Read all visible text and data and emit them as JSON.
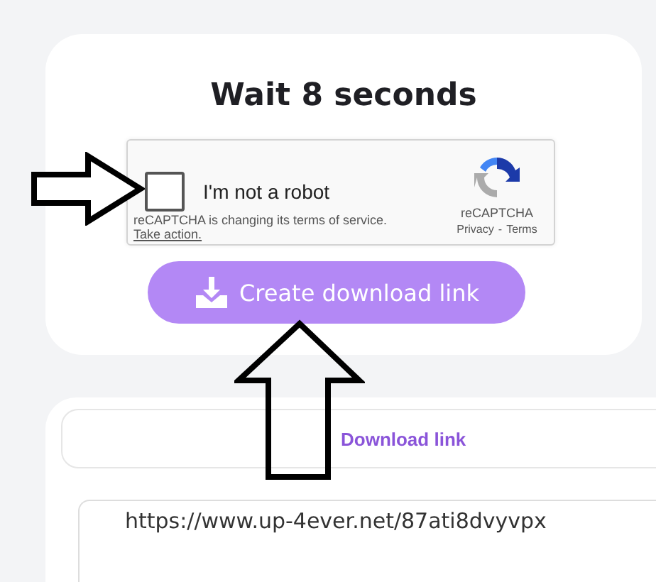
{
  "countdown_card": {
    "title": "Wait 8 seconds",
    "recaptcha": {
      "checked": false,
      "label": "I'm not a robot",
      "notice": "reCAPTCHA is changing its terms of service.",
      "action_link": "Take action.",
      "brand": "reCAPTCHA",
      "privacy_link": "Privacy",
      "separator": "-",
      "terms_link": "Terms"
    },
    "button": "Create download link"
  },
  "link_card": {
    "tabs": [
      {
        "label": "Download link",
        "selected": true
      }
    ],
    "link_field": {
      "value": "https://www.up-4ever.net/87ati8dvyvpx"
    }
  }
}
